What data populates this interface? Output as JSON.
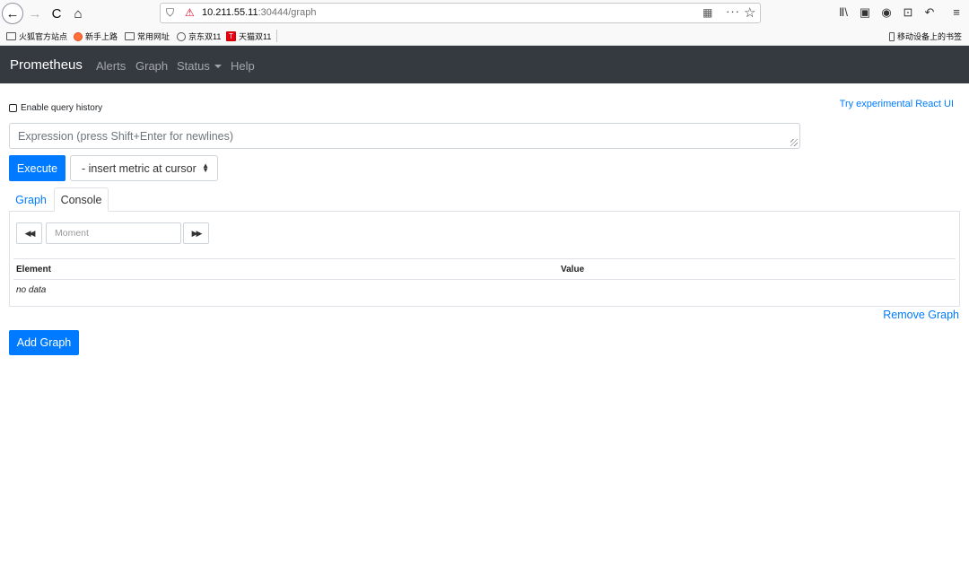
{
  "browser": {
    "url_host": "10.211.55.11",
    "url_path": ":30444/graph",
    "back_glyph": "←",
    "forward_glyph": "→",
    "reload_glyph": "C",
    "home_glyph": "⌂",
    "more_glyph": "···",
    "star_glyph": "☆",
    "library_glyph": "Ⅱ\\",
    "sidebar_glyph": "▣",
    "account_glyph": "◉",
    "crop_glyph": "⊡",
    "undo_glyph": "↶",
    "menu_glyph": "≡"
  },
  "bookmarks": {
    "items": [
      {
        "label": "火狐官方站点",
        "icon": "folder-icon"
      },
      {
        "label": "新手上路",
        "icon": "firefox-icon"
      },
      {
        "label": "常用网址",
        "icon": "folder-icon"
      },
      {
        "label": "京东双11",
        "icon": "globe-icon"
      },
      {
        "label": "天猫双11",
        "icon": "tmall-icon"
      }
    ],
    "mobile_label": "移动设备上的书签"
  },
  "navbar": {
    "brand": "Prometheus",
    "links": [
      "Alerts",
      "Graph",
      "Status",
      "Help"
    ]
  },
  "query": {
    "history_label": "Enable query history",
    "history_checked": false,
    "react_link": "Try experimental React UI",
    "expression_placeholder": "Expression (press Shift+Enter for newlines)",
    "execute_label": "Execute",
    "metric_select": "- insert metric at cursor"
  },
  "tabs": {
    "graph": "Graph",
    "console": "Console",
    "active": "Console"
  },
  "console": {
    "moment_placeholder": "Moment",
    "back_glyph": "◀◀",
    "forward_glyph": "▶▶",
    "columns": [
      "Element",
      "Value"
    ],
    "empty_text": "no data"
  },
  "actions": {
    "remove_graph": "Remove Graph",
    "add_graph": "Add Graph"
  },
  "colors": {
    "navbar_bg": "#343a40",
    "primary": "#007bff"
  }
}
